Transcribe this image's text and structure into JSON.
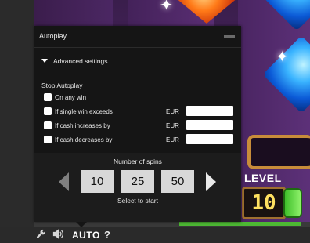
{
  "panel": {
    "title": "Autoplay",
    "advanced_label": "Advanced settings",
    "stop_title": "Stop Autoplay",
    "options": [
      {
        "label": "On any win",
        "has_input": false
      },
      {
        "label": "If single win exceeds",
        "currency": "EUR",
        "value": ""
      },
      {
        "label": "If cash increases by",
        "currency": "EUR",
        "value": ""
      },
      {
        "label": "If cash decreases by",
        "currency": "EUR",
        "value": ""
      }
    ],
    "spins": {
      "title": "Number of spins",
      "options": [
        "10",
        "25",
        "50"
      ],
      "hint": "Select to start"
    }
  },
  "game": {
    "level_label": "LEVEL",
    "level_value": "10",
    "progress_fraction": 0.44
  },
  "toolbar": {
    "auto_label": "AUTO",
    "help_label": "?",
    "icons": [
      "wrench-icon",
      "speaker-icon"
    ]
  },
  "colors": {
    "panel_bg": "#151515",
    "progress_green": "#4db833",
    "level_digits": "#ffe060"
  }
}
